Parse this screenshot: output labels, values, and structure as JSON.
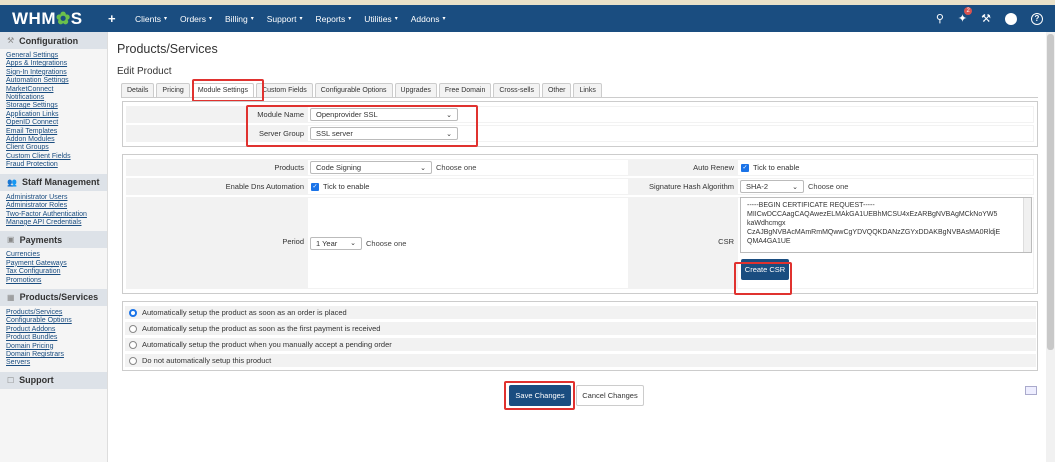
{
  "app": {
    "logo_prefix": "WHM",
    "logo_mid": "✿",
    "logo_suffix": "S"
  },
  "nav": {
    "plus": "+",
    "items": [
      "Clients",
      "Orders",
      "Billing",
      "Support",
      "Reports",
      "Utilities",
      "Addons"
    ],
    "notif_count": "2",
    "help": "?"
  },
  "sidebar": {
    "sections": [
      {
        "title": "Configuration",
        "icon": "wrench-icon",
        "glyph": "⚒",
        "links": [
          "General Settings",
          "Apps & Integrations",
          "Sign-In Integrations",
          "Automation Settings",
          "MarketConnect",
          "Notifications",
          "Storage Settings",
          "Application Links",
          "OpenID Connect",
          "Email Templates",
          "Addon Modules",
          "Client Groups",
          "Custom Client Fields",
          "Fraud Protection"
        ]
      },
      {
        "title": "Staff Management",
        "icon": "users-icon",
        "glyph": "👥",
        "links": [
          "Administrator Users",
          "Administrator Roles",
          "Two-Factor Authentication",
          "Manage API Credentials"
        ]
      },
      {
        "title": "Payments",
        "icon": "money-icon",
        "glyph": "▣",
        "links": [
          "Currencies",
          "Payment Gateways",
          "Tax Configuration",
          "Promotions"
        ]
      },
      {
        "title": "Products/Services",
        "icon": "box-icon",
        "glyph": "▦",
        "links": [
          "Products/Services",
          "Configurable Options",
          "Product Addons",
          "Product Bundles",
          "Domain Pricing",
          "Domain Registrars",
          "Servers"
        ]
      },
      {
        "title": "Support",
        "icon": "support-icon",
        "glyph": "☐",
        "links": []
      }
    ]
  },
  "page": {
    "title": "Products/Services",
    "subtitle": "Edit Product"
  },
  "tabs": [
    "Details",
    "Pricing",
    "Module Settings",
    "Custom Fields",
    "Configurable Options",
    "Upgrades",
    "Free Domain",
    "Cross-sells",
    "Other",
    "Links"
  ],
  "module": {
    "module_name_label": "Module Name",
    "module_name_value": "Openprovider SSL",
    "server_group_label": "Server Group",
    "server_group_value": "SSL server"
  },
  "settings": {
    "products_label": "Products",
    "products_value": "Code Signing",
    "products_hint": "Choose one",
    "dns_label": "Enable Dns Automation",
    "dns_hint": "Tick to enable",
    "period_label": "Period",
    "period_value": "1 Year",
    "period_hint": "Choose one",
    "auto_renew_label": "Auto Renew",
    "auto_renew_hint": "Tick to enable",
    "sig_label": "Signature Hash Algorithm",
    "sig_value": "SHA-2",
    "sig_hint": "Choose one",
    "csr_label": "CSR",
    "csr_lines": [
      "-----BEGIN CERTIFICATE REQUEST-----",
      "MIICwDCCAagCAQAwezELMAkGA1UEBhMCSU4xEzARBgNVBAgMCkNoYW5",
      "kaWdhcmgx",
      "CzAJBgNVBAcMAmRmMQwwCgYDVQQKDANzZGYxDDAKBgNVBAsMA0RldjE",
      "QMA4GA1UE"
    ],
    "create_csr": "Create CSR"
  },
  "setup_options": [
    "Automatically setup the product as soon as an order is placed",
    "Automatically setup the product as soon as the first payment is received",
    "Automatically setup the product when you manually accept a pending order",
    "Do not automatically setup this product"
  ],
  "actions": {
    "save": "Save Changes",
    "cancel": "Cancel Changes"
  }
}
